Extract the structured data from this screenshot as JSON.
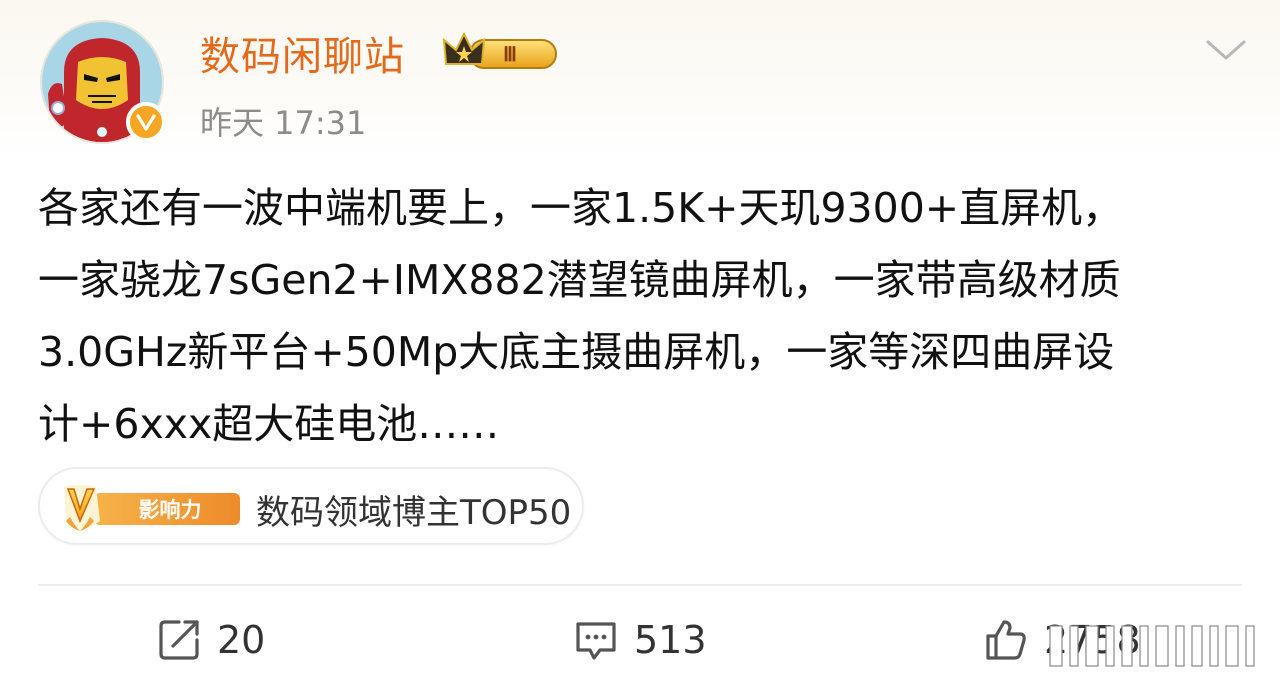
{
  "post": {
    "author": {
      "name": "数码闲聊站",
      "vip_level": "Ⅲ"
    },
    "time": "昨天 17:31",
    "content_lines": [
      "各家还有一波中端机要上，一家1.5K+天玑9300+直屏机，",
      "一家骁龙7sGen2+IMX882潜望镜曲屏机，一家带高级材质",
      "3.0GHz新平台+50Mp大底主摄曲屏机，一家等深四曲屏设",
      "计+6xxx超大硅电池……"
    ],
    "influence_tag": {
      "icon_label": "影响力",
      "text": "数码领域博主TOP50"
    },
    "actions": {
      "repost_count": "20",
      "comment_count": "513",
      "like_count": "2758"
    }
  },
  "colors": {
    "author_name": "#e36a1b",
    "verified": "#f5a623",
    "muted": "#8c8c8c"
  }
}
